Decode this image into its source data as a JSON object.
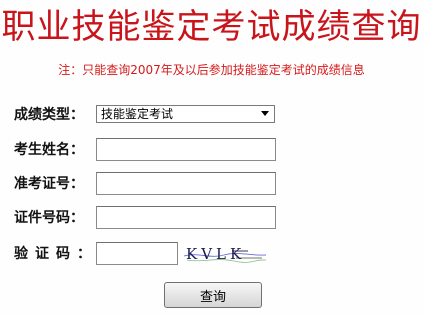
{
  "page": {
    "title": "职业技能鉴定考试成绩查询",
    "notice": "注：只能查询2007年及以后参加技能鉴定考试的成绩信息"
  },
  "form": {
    "score_type": {
      "label": "成绩类型：",
      "selected": "技能鉴定考试"
    },
    "name": {
      "label": "考生姓名：",
      "value": ""
    },
    "exam_id": {
      "label": "准考证号：",
      "value": ""
    },
    "id_number": {
      "label": "证件号码：",
      "value": ""
    },
    "captcha": {
      "label": "验证码：",
      "value": "",
      "image_text": "KVLK"
    },
    "submit_label": "查询"
  }
}
